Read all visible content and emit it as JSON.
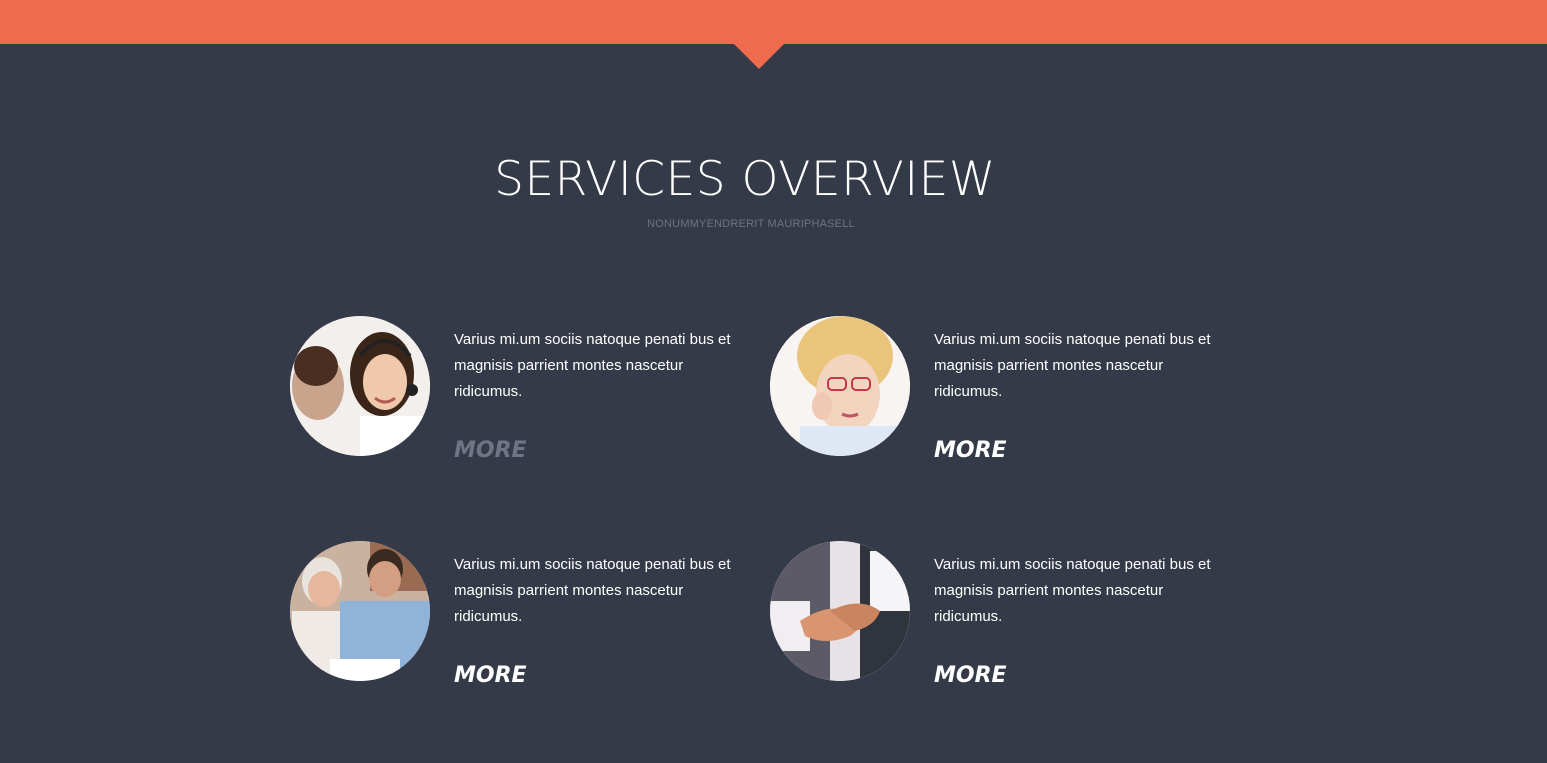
{
  "header": {
    "title": "SERVICES OVERVIEW",
    "subtitle": "NONUMMYENDRERIT MAURIPHASELL"
  },
  "colors": {
    "accent": "#ef6b4d",
    "background": "#343a47",
    "text": "#ffffff",
    "muted": "#6c7382"
  },
  "services": [
    {
      "image": "customer-support-photo",
      "text": "Varius mi.um sociis natoque penati bus et magnisis parrient montes nascetur ridicumus.",
      "more_label": "MORE"
    },
    {
      "image": "woman-with-glasses-photo",
      "text": "Varius mi.um sociis natoque penati bus et magnisis parrient montes nascetur ridicumus.",
      "more_label": "MORE"
    },
    {
      "image": "senior-couple-photo",
      "text": "Varius mi.um sociis natoque penati bus et magnisis parrient montes nascetur ridicumus.",
      "more_label": "MORE"
    },
    {
      "image": "handshake-photo",
      "text": "Varius mi.um sociis natoque penati bus et magnisis parrient montes nascetur ridicumus.",
      "more_label": "MORE"
    }
  ]
}
